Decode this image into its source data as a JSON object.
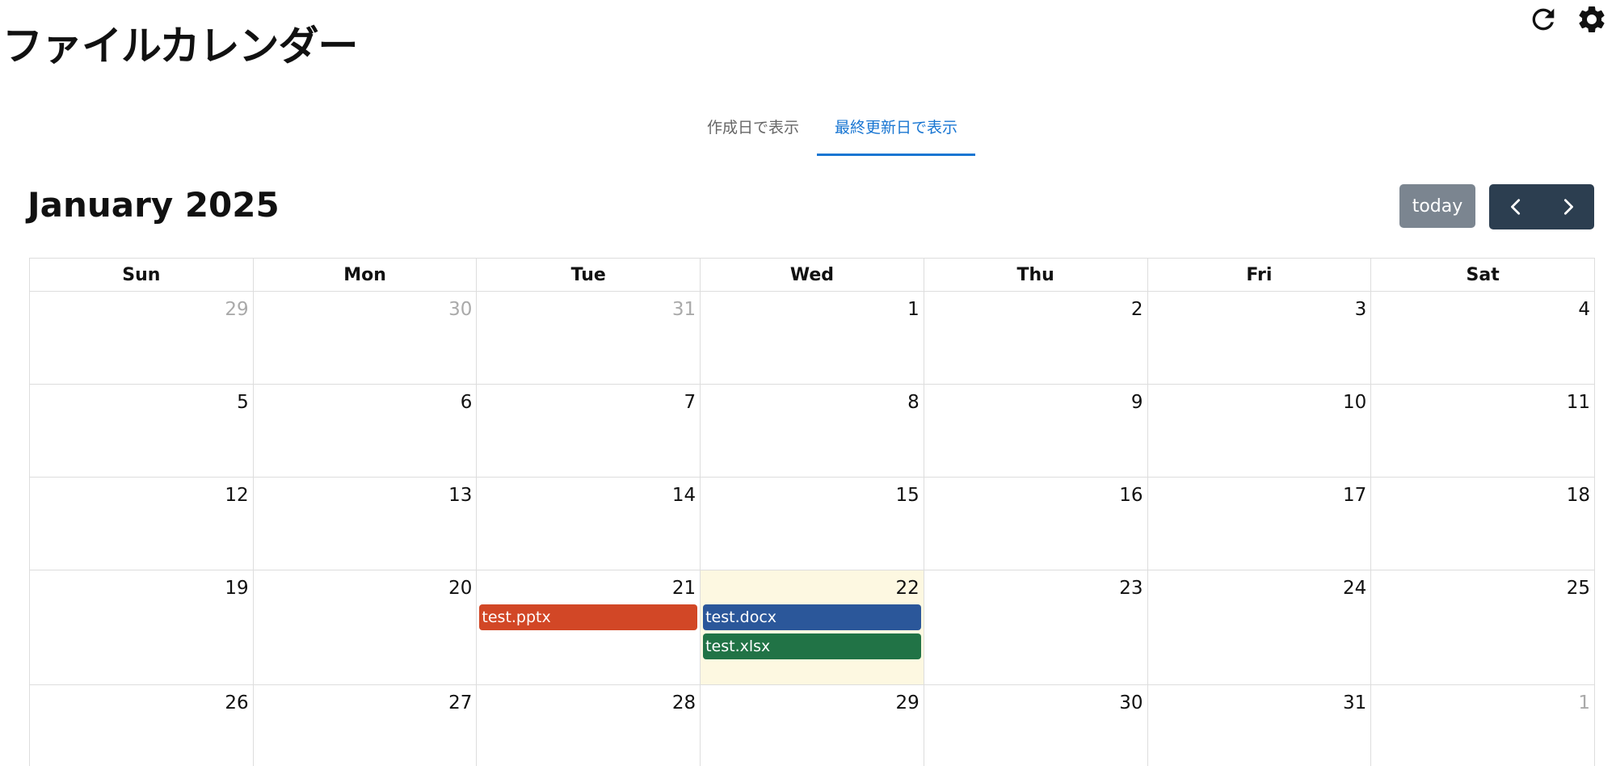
{
  "app": {
    "title": "ファイルカレンダー"
  },
  "icons": {
    "refresh": "refresh-icon",
    "settings": "gear-icon"
  },
  "tabs": [
    {
      "label": "作成日で表示",
      "active": false
    },
    {
      "label": "最終更新日で表示",
      "active": true
    }
  ],
  "calendar": {
    "title": "January 2025",
    "today_label": "today",
    "weekdays": [
      "Sun",
      "Mon",
      "Tue",
      "Wed",
      "Thu",
      "Fri",
      "Sat"
    ],
    "weeks": [
      [
        {
          "d": "29",
          "other": true
        },
        {
          "d": "30",
          "other": true
        },
        {
          "d": "31",
          "other": true
        },
        {
          "d": "1"
        },
        {
          "d": "2"
        },
        {
          "d": "3"
        },
        {
          "d": "4"
        }
      ],
      [
        {
          "d": "5"
        },
        {
          "d": "6"
        },
        {
          "d": "7"
        },
        {
          "d": "8"
        },
        {
          "d": "9"
        },
        {
          "d": "10"
        },
        {
          "d": "11"
        }
      ],
      [
        {
          "d": "12"
        },
        {
          "d": "13"
        },
        {
          "d": "14"
        },
        {
          "d": "15"
        },
        {
          "d": "16"
        },
        {
          "d": "17"
        },
        {
          "d": "18"
        }
      ],
      [
        {
          "d": "19"
        },
        {
          "d": "20"
        },
        {
          "d": "21",
          "events": [
            {
              "title": "test.pptx",
              "color": "#d24726"
            }
          ]
        },
        {
          "d": "22",
          "today": true,
          "events": [
            {
              "title": "test.docx",
              "color": "#2b579a"
            },
            {
              "title": "test.xlsx",
              "color": "#217346"
            }
          ]
        },
        {
          "d": "23"
        },
        {
          "d": "24"
        },
        {
          "d": "25"
        }
      ],
      [
        {
          "d": "26"
        },
        {
          "d": "27"
        },
        {
          "d": "28"
        },
        {
          "d": "29"
        },
        {
          "d": "30"
        },
        {
          "d": "31"
        },
        {
          "d": "1",
          "other": true
        }
      ]
    ]
  },
  "colors": {
    "accent": "#1976d2",
    "nav_dark": "#2c3e50",
    "today_button": "#7b8590",
    "today_cell": "#fdf8e1"
  }
}
